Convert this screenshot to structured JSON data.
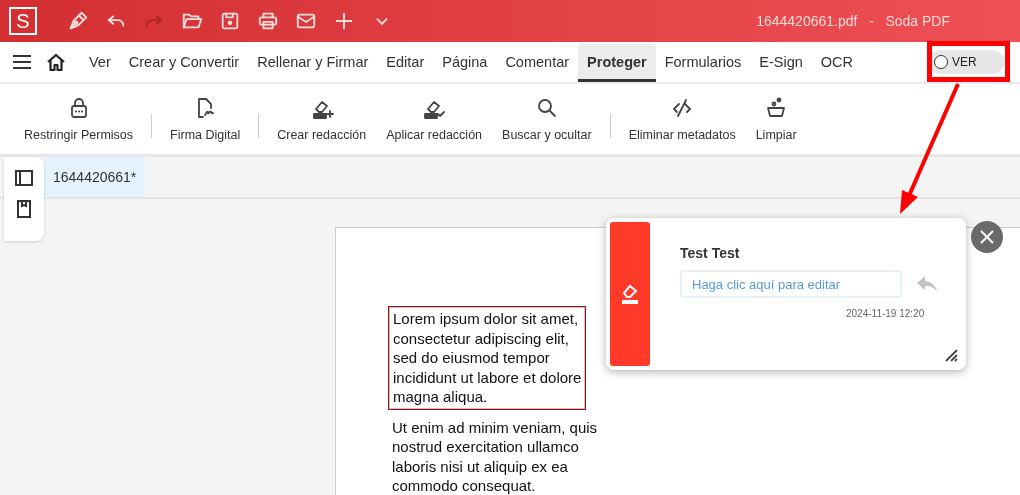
{
  "app": {
    "logo": "S",
    "title": "1644420661.pdf   -   Soda PDF"
  },
  "quick_tools": [
    {
      "kind": "pen",
      "disabled": false
    },
    {
      "kind": "undo",
      "disabled": false
    },
    {
      "kind": "redo",
      "disabled": true
    },
    {
      "kind": "open",
      "disabled": false
    },
    {
      "kind": "save",
      "disabled": false
    },
    {
      "kind": "print",
      "disabled": false
    },
    {
      "kind": "mail",
      "disabled": false
    },
    {
      "kind": "add",
      "disabled": false
    },
    {
      "kind": "more",
      "disabled": false
    }
  ],
  "menu_tabs": [
    {
      "label": "Ver",
      "selected": false
    },
    {
      "label": "Crear y Convertir",
      "selected": false
    },
    {
      "label": "Rellenar y Firmar",
      "selected": false
    },
    {
      "label": "Editar",
      "selected": false
    },
    {
      "label": "Página",
      "selected": false
    },
    {
      "label": "Comentar",
      "selected": false
    },
    {
      "label": "Proteger",
      "selected": true
    },
    {
      "label": "Formularios",
      "selected": false
    },
    {
      "label": "E-Sign",
      "selected": false
    },
    {
      "label": "OCR",
      "selected": false
    }
  ],
  "view_toggle": {
    "label": "VER",
    "on": false
  },
  "ribbon": [
    {
      "kind": "lock",
      "label": "Restringir Permisos",
      "separator_after": true
    },
    {
      "kind": "sign",
      "label": "Firma Digital",
      "separator_after": true
    },
    {
      "kind": "redact-add",
      "label": "Crear redacción",
      "separator_after": false
    },
    {
      "kind": "redact-apply",
      "label": "Aplicar redacción",
      "separator_after": false
    },
    {
      "kind": "search",
      "label": "Buscar y ocultar",
      "separator_after": true
    },
    {
      "kind": "metadata",
      "label": "Eliminar metadatos",
      "separator_after": false
    },
    {
      "kind": "clean",
      "label": "Limpiar",
      "separator_after": false
    }
  ],
  "document_tabs": [
    {
      "label": "1644420661*",
      "selected": true
    }
  ],
  "side_panel": [
    {
      "kind": "panel"
    },
    {
      "kind": "bookmark"
    }
  ],
  "page": {
    "paragraphs": [
      {
        "text": "Lorem ipsum dolor sit amet,\nconsectetur adipiscing elit,\nsed do eiusmod tempor\nincididunt ut labore et dolore\nmagna aliqua.",
        "marked": true
      },
      {
        "text": "Ut enim ad minim veniam, quis\nnostrud exercitation ullamco\nlaboris nisi ut aliquip ex ea\ncommodo consequat.",
        "marked": false
      }
    ]
  },
  "comment": {
    "author": "Test Test",
    "placeholder": "Haga clic aquí para editar",
    "time": "2024-11-19 12:20"
  }
}
